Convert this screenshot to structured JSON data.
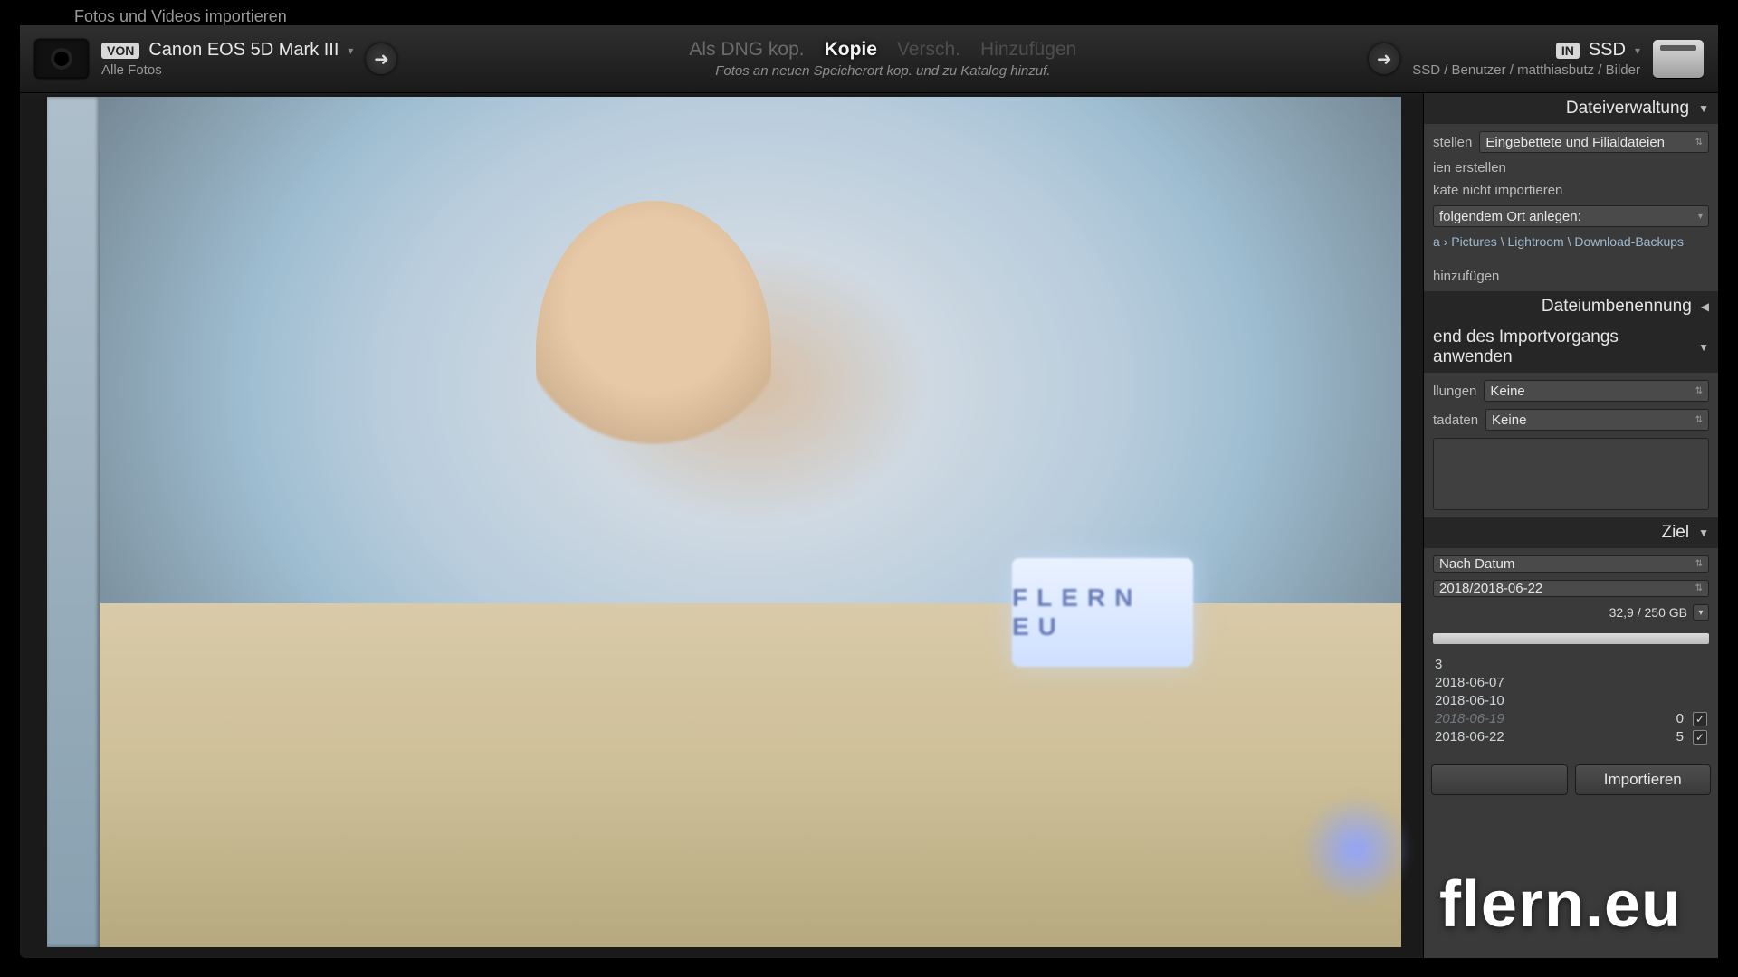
{
  "menubar": "Fotos und Videos importieren",
  "header": {
    "source": {
      "badge": "VON",
      "title": "Canon EOS 5D Mark III",
      "subtitle": "Alle Fotos"
    },
    "modes": {
      "as_dng": "Als DNG kop.",
      "copy": "Kopie",
      "move": "Versch.",
      "add": "Hinzufügen"
    },
    "modes_sub": "Fotos an neuen Speicherort kop. und zu Katalog hinzuf.",
    "destination": {
      "badge": "IN",
      "title": "SSD",
      "subtitle": "SSD / Benutzer / matthiasbutz / Bilder"
    }
  },
  "panel": {
    "file_handling": {
      "title": "Dateiverwaltung",
      "preview_label": "stellen",
      "preview_value": "Eingebettete und Filialdateien",
      "smart_previews": "ien erstellen",
      "no_duplicates": "kate nicht importieren",
      "second_copy_label": "folgendem Ort anlegen:",
      "second_copy_path": "a › Pictures \\ Lightroom \\ Download-Backups",
      "add_to_collection": "hinzufügen"
    },
    "file_renaming": {
      "title": "Dateiumbenennung"
    },
    "apply_during": {
      "title": "end des Importvorgangs anwenden",
      "develop_label": "llungen",
      "develop_value": "Keine",
      "metadata_label": "tadaten",
      "metadata_value": "Keine"
    },
    "destination": {
      "title": "Ziel",
      "organize_value": "Nach Datum",
      "date_format_value": "2018/2018-06-22",
      "storage_text": "32,9 / 250 GB",
      "tree_root": "3",
      "dates": [
        {
          "label": "2018-06-07",
          "count": "",
          "checked": false,
          "dim": false
        },
        {
          "label": "2018-06-10",
          "count": "",
          "checked": false,
          "dim": false
        },
        {
          "label": "2018-06-19",
          "count": "0",
          "checked": true,
          "dim": true
        },
        {
          "label": "2018-06-22",
          "count": "5",
          "checked": true,
          "dim": false
        }
      ]
    },
    "footer": {
      "cancel": "",
      "import": "Importieren"
    }
  },
  "overlay": {
    "monitor_text": "FLERN EU",
    "watermark": "flern.eu"
  }
}
